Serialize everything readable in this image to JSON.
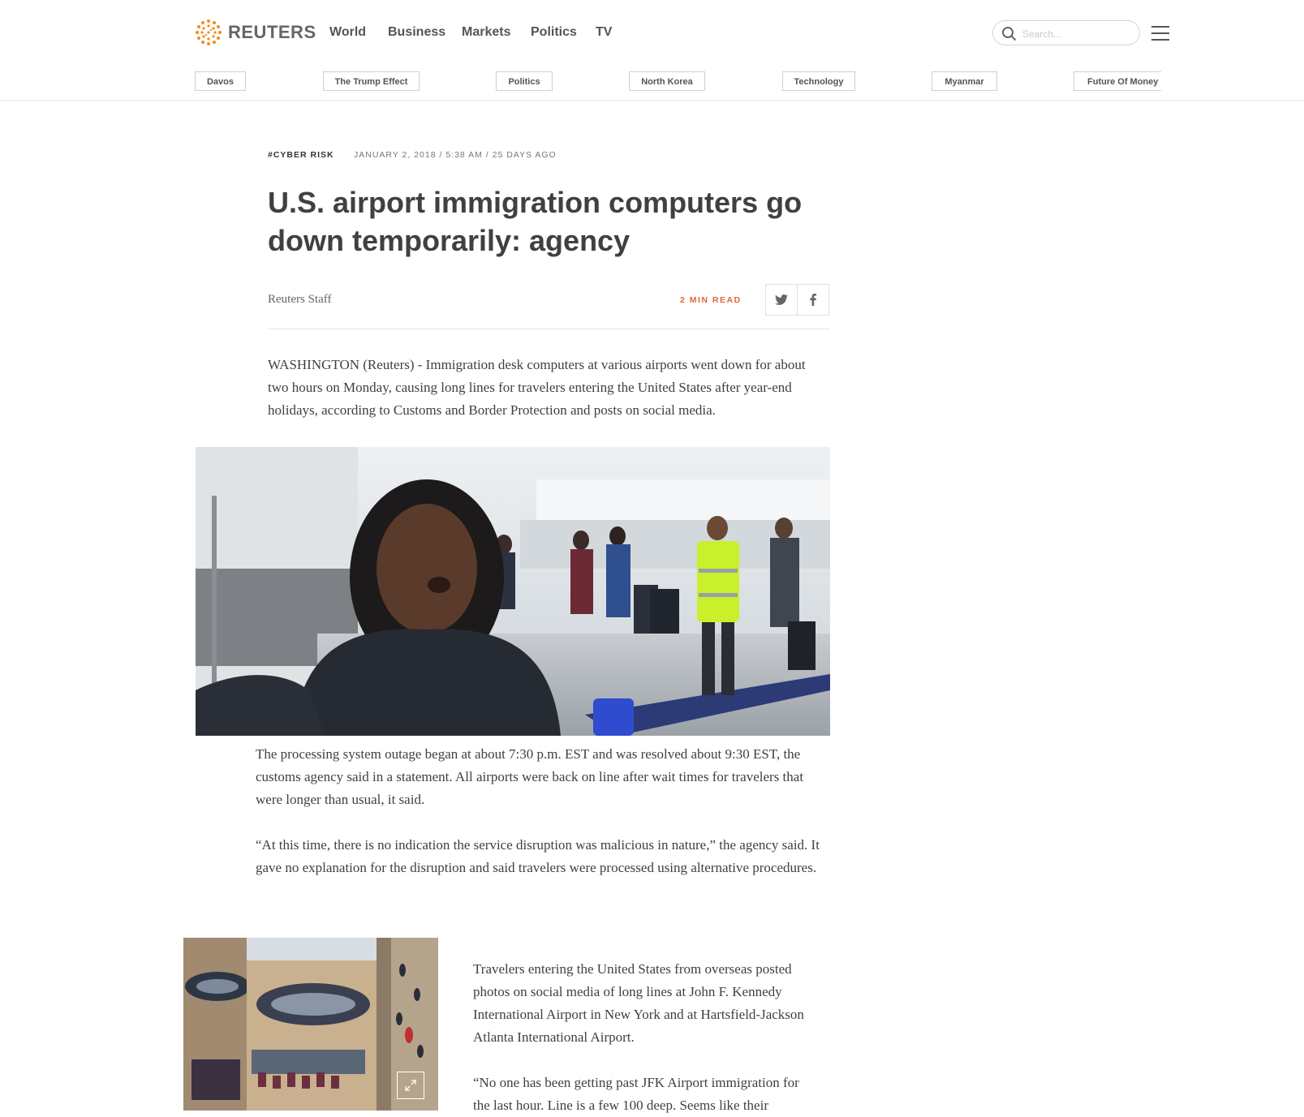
{
  "header": {
    "brand": "REUTERS",
    "nav": [
      "World",
      "Business",
      "Markets",
      "Politics",
      "TV"
    ],
    "search_placeholder": "Search...",
    "topics": [
      "Davos",
      "The Trump Effect",
      "Politics",
      "North Korea",
      "Technology",
      "Myanmar",
      "Future Of Money"
    ]
  },
  "article": {
    "kicker": "#CYBER RISK",
    "dateline": "JANUARY 2, 2018 / 5:38 AM / 25 DAYS AGO",
    "headline": "U.S. airport immigration computers go down temporarily: agency",
    "byline": "Reuters Staff",
    "read_time": "2 MIN READ",
    "paragraphs": [
      "WASHINGTON (Reuters) - Immigration desk computers at various airports went down for about two hours on Monday, causing long lines for travelers entering the United States after year-end holidays, according to Customs and Border Protection and posts on social media.",
      "The processing system outage began at about 7:30 p.m. EST and was resolved about 9:30 EST, the customs agency said in a statement. All airports were back on line after wait times for travelers that were longer than usual, it said.",
      "“At this time, there is no indication the service disruption was malicious in nature,” the agency said. It gave no explanation for the disruption and said travelers were processed using alternative procedures.",
      "Travelers entering the United States from overseas posted photos on social media of long lines at John F. Kennedy International Airport in New York and at Hartsfield-Jackson Atlanta International Airport.",
      "“No one has been getting past JFK Airport immigration for the last hour. Line is a few 100 deep. Seems like their"
    ]
  },
  "colors": {
    "accent": "#e0673a",
    "logo": "#f08c1e",
    "text": "#404040"
  },
  "icons": [
    "reuters-logo-icon",
    "search-icon",
    "menu-icon",
    "twitter-icon",
    "facebook-icon",
    "expand-icon"
  ]
}
